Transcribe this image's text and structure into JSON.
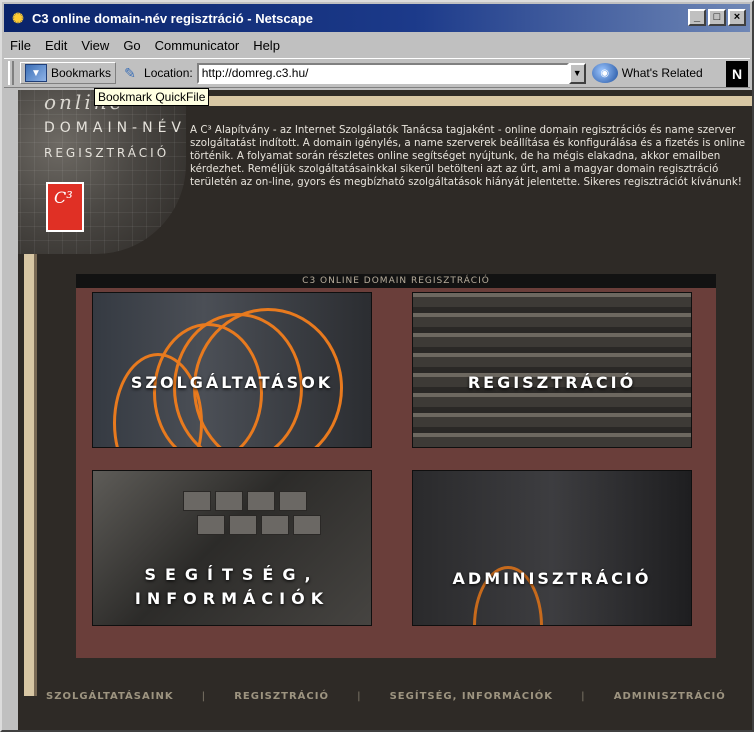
{
  "window": {
    "title": "C3 online domain-név regisztráció - Netscape",
    "controls": [
      "_",
      "□",
      "×"
    ]
  },
  "menu": {
    "items": [
      "File",
      "Edit",
      "View",
      "Go",
      "Communicator",
      "Help"
    ]
  },
  "toolbar": {
    "bookmarks_label": "Bookmarks",
    "location_label": "Location:",
    "url": "http://domreg.c3.hu/",
    "whats_related_label": "What's Related"
  },
  "tooltip": "Bookmark QuickFile",
  "logo": {
    "online": "online",
    "domain": "DOMAIN-NÉV",
    "reg": "REGISZTRÁCIÓ",
    "badge": "C³"
  },
  "intro": "A C³ Alapítvány - az Internet Szolgálatók Tanácsa tagjaként - online domain regisztrációs és name szerver szolgáltatást indított. A domain igénylés, a name szerverek beállítása és konfigurálása és a fizetés is online történik. A folyamat során részletes online segítséget nyújtunk, de ha mégis elakadna, akkor emailben kérdezhet. Reméljük szolgáltatásainkkal sikerül betölteni azt az űrt, ami a magyar domain regisztráció területén az on-line, gyors és megbízható szolgáltatások hiányát jelentette. Sikeres regisztrációt kívánunk!",
  "panel": {
    "title": "C3 ONLINE DOMAIN REGISZTRÁCIÓ",
    "tiles": [
      "SZOLGÁLTATÁSOK",
      "REGISZTRÁCIÓ",
      "SEGÍTSÉG,",
      "INFORMÁCIÓK",
      "ADMINISZTRÁCIÓ"
    ]
  },
  "footer": {
    "links": [
      "SZOLGÁLTATÁSAINK",
      "REGISZTRÁCIÓ",
      "SEGÍTSÉG, INFORMÁCIÓK",
      "ADMINISZTRÁCIÓ"
    ],
    "separator": "|"
  },
  "colors": {
    "titlebar": "#0a246a",
    "panel_bg": "#6a3e3a",
    "page_bg": "#2e2a26",
    "logo_badge": "#e03025"
  }
}
